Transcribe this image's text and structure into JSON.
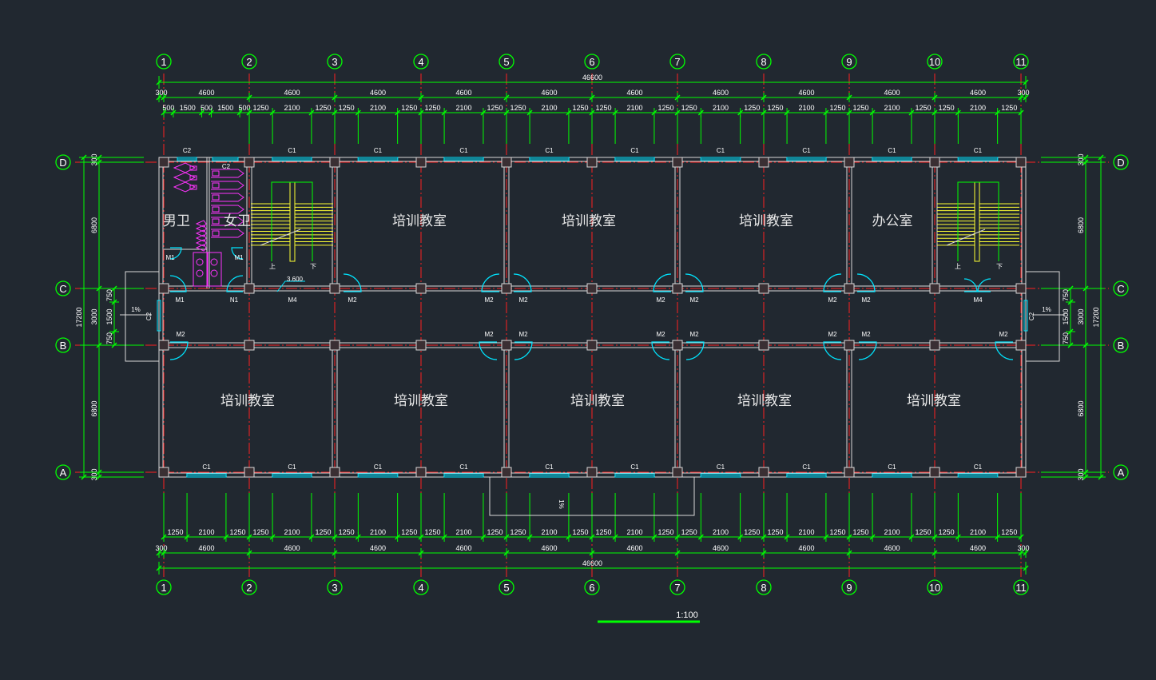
{
  "axes": {
    "columns": [
      "1",
      "2",
      "3",
      "4",
      "5",
      "6",
      "7",
      "8",
      "9",
      "10",
      "11"
    ],
    "rows": [
      "D",
      "C",
      "B",
      "A"
    ]
  },
  "dims": {
    "overall": "46600",
    "overall_bottom": "46600",
    "end_offset": "300",
    "bay": "4600",
    "top_detail_bay1": [
      "500",
      "1500",
      "500",
      "1500",
      "500"
    ],
    "window_segments": [
      "1250",
      "2100",
      "1250"
    ],
    "left_vertical": [
      "300",
      "6800",
      "750",
      "1500",
      "750",
      "6800",
      "300"
    ],
    "left_total": "17200",
    "corridor": "3000",
    "right_vertical": [
      "300",
      "6800",
      "750",
      "1500",
      "750",
      "6800",
      "300"
    ],
    "right_total": "17200"
  },
  "rooms": {
    "mens_wc": "男卫",
    "womens_wc": "女卫",
    "north_training_1": "培训教室",
    "north_training_2": "培训教室",
    "north_training_3": "培训教室",
    "office": "办公室",
    "south_training_1": "培训教室",
    "south_training_2": "培训教室",
    "south_training_3": "培训教室",
    "south_training_4": "培训教室",
    "south_training_5": "培训教室"
  },
  "tags": {
    "window_c1": "C1",
    "window_c2": "C2",
    "door_m1": "M1",
    "door_m2": "M2",
    "door_m4": "M4",
    "door_n1": "N1",
    "stair_up": "上",
    "stair_down": "下",
    "level": "3.600",
    "slope": "1%"
  },
  "scale": "1:100",
  "colors": {
    "background": "#212830",
    "dimension": "#00ff00",
    "axis": "#ff2020",
    "wall": "#d9d9d9",
    "window": "#00e5ff",
    "door": "#00e5ff",
    "stair": "#ffff33",
    "fixture": "#ff33ff"
  }
}
